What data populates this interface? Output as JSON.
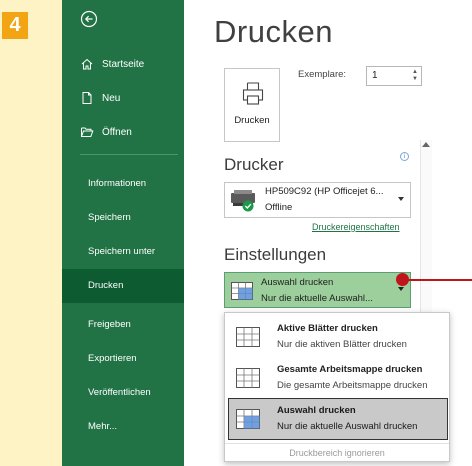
{
  "step_badge": "4",
  "sidebar": {
    "top_items": [
      {
        "label": "Startseite",
        "icon": "home-icon"
      },
      {
        "label": "Neu",
        "icon": "new-document-icon"
      },
      {
        "label": "Öffnen",
        "icon": "folder-open-icon"
      }
    ],
    "items": [
      {
        "label": "Informationen"
      },
      {
        "label": "Speichern"
      },
      {
        "label": "Speichern unter"
      },
      {
        "label": "Drucken",
        "active": true
      },
      {
        "label": "Freigeben"
      },
      {
        "label": "Exportieren"
      },
      {
        "label": "Veröffentlichen"
      },
      {
        "label": "Mehr..."
      }
    ]
  },
  "page": {
    "title": "Drucken",
    "print_button_label": "Drucken",
    "copies_label": "Exemplare:",
    "copies_value": "1"
  },
  "printer": {
    "section_title": "Drucker",
    "name": "HP509C92 (HP Officejet 6...",
    "status": "Offline",
    "properties_link": "Druckereigenschaften"
  },
  "settings": {
    "section_title": "Einstellungen",
    "selected_title": "Auswahl drucken",
    "selected_desc": "Nur die aktuelle Auswahl..."
  },
  "dropdown": {
    "options": [
      {
        "title": "Aktive Blätter drucken",
        "desc": "Nur die aktiven Blätter drucken"
      },
      {
        "title": "Gesamte Arbeitsmappe drucken",
        "desc": "Die gesamte Arbeitsmappe drucken"
      },
      {
        "title": "Auswahl drucken",
        "desc": "Nur die aktuelle Auswahl drucken",
        "selected": true
      }
    ],
    "footer": "Druckbereich ignorieren"
  },
  "colors": {
    "sidebar": "#217346",
    "sidebar_active": "#0d5b31",
    "badge": "#f2a413",
    "marker": "#c0141c",
    "selected_setting": "#9ccf9c"
  }
}
